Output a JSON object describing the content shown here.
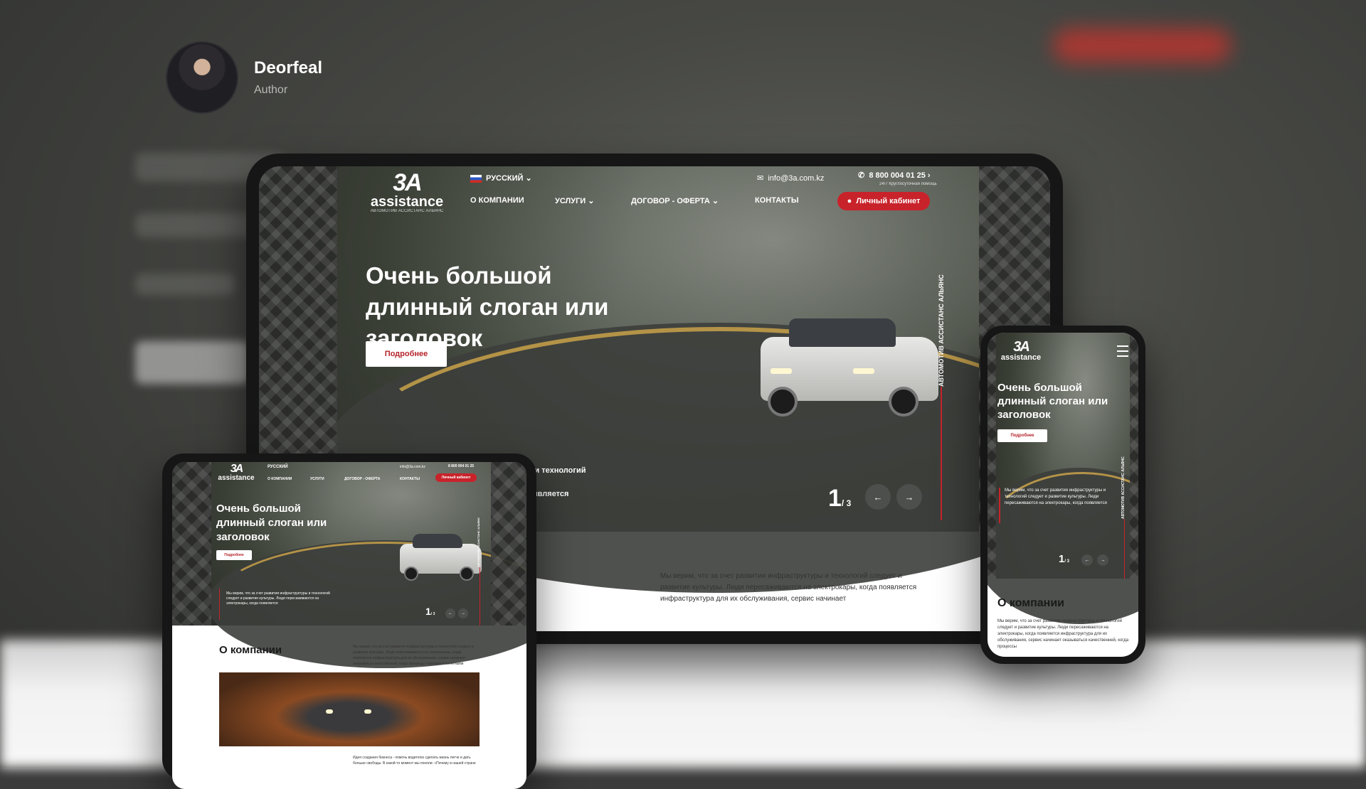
{
  "author": {
    "name": "Deorfeal",
    "role": "Author"
  },
  "site": {
    "logo_mark": "3A",
    "logo_word": "assistance",
    "logo_sub": "АВТОМОТИВ АССИСТАНС АЛЬЯНС",
    "language": "РУССКИЙ",
    "email": "info@3a.com.kz",
    "phone": "8 800 004 01 25",
    "phone_note": "24/7 Круглосуточная помощь",
    "nav": [
      "О КОМПАНИИ",
      "УСЛУГИ",
      "ДОГОВОР - ОФЕРТА",
      "КОНТАКТЫ"
    ],
    "account_button": "Личный кабинет",
    "headline": "Очень большой длинный слоган или заголовок",
    "more_button": "Подробнее",
    "vertical_label": "АВТОМОТИВ АССИСТАНС АЛЬЯНС",
    "slider_current": "1",
    "slider_total": "/ 3",
    "prev_arrow": "←",
    "next_arrow": "→",
    "hero_caption_1": "уктуры и технологий",
    "hero_caption_2": "огда появляется",
    "hero_small_text": "Мы верим, что за счет развития инфраструктуры и технологий следует и развитие культуры. Люди пересаживаются на электрокары, когда появляется",
    "about_title": "О компании",
    "about_text": "Мы верим, что за счет развития инфраструктуры и технологий следует и развитие культуры. Люди пересаживаются на электрокары, когда появляется инфраструктура для их обслуживания, сервис начинает",
    "about_text_mobile": "Мы верим, что за счет развития инфраструктуры и технологий следует и развитие культуры. Люди пересаживаются на электрокары, когда появляется инфраструктура для их обслуживания, сервис начинает оказываться качественней, когда процессы",
    "about_text_tablet": "Мы верим, что за счет развития инфраструктуры и технологий следует и развитие культуры. Люди пересаживаются на электрокары, когда появляется инфраструктура для их обслуживания, сервис начинает оказываться качественней, когда процессы становятся понятными",
    "below_text": "Идея создания бизнеса - помочь водителю сделать жизнь легче и дать больше свободы. В какой-то момент мы поняли: «Почему в нашей стране"
  },
  "colors": {
    "brand_red": "#c8232b",
    "accent_road": "#c9a24a"
  },
  "icons": [
    "mail-icon",
    "phone-icon",
    "user-icon",
    "chevron-down-icon",
    "arrow-left-icon",
    "arrow-right-icon",
    "menu-icon",
    "flag-ru-icon"
  ]
}
